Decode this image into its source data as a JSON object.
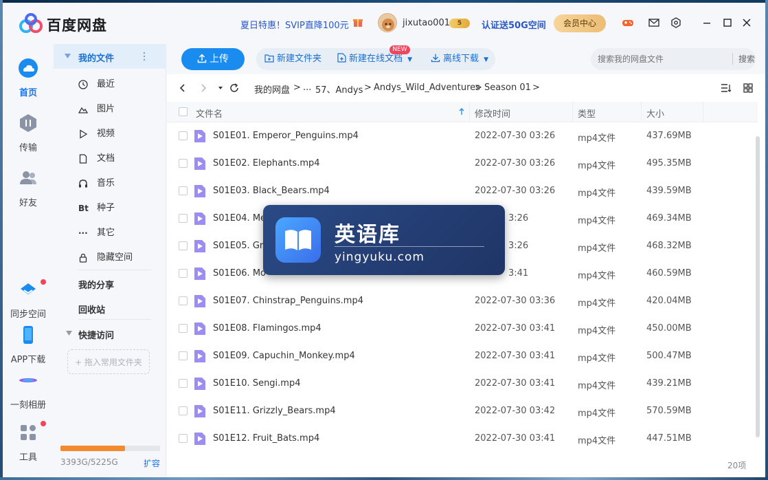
{
  "app": {
    "logo_text": "百度网盘",
    "promo": "夏日特惠！SVIP直降100元",
    "username": "jixutao001",
    "vip_badge": "5",
    "verify": "认证送50G空间",
    "member_center": "会员中心"
  },
  "leftnav": {
    "home": "首页",
    "transfer": "传输",
    "friends": "好友",
    "sync": "同步空间",
    "app_download": "APP下载",
    "moment_album": "一刻相册",
    "tools": "工具"
  },
  "sidebar": {
    "my_files": "我的文件",
    "items": [
      {
        "label": "最近",
        "icon": "clock-icon"
      },
      {
        "label": "图片",
        "icon": "image-icon"
      },
      {
        "label": "视频",
        "icon": "play-icon"
      },
      {
        "label": "文档",
        "icon": "document-icon"
      },
      {
        "label": "音乐",
        "icon": "headphones-icon"
      },
      {
        "label": "种子",
        "icon": "bt-icon"
      },
      {
        "label": "其它",
        "icon": "more-icon"
      },
      {
        "label": "隐藏空间",
        "icon": "lock-icon"
      }
    ],
    "my_share": "我的分享",
    "recycle": "回收站",
    "quick_access": "快捷访问",
    "quick_drop": "+ 拖入常用文件夹",
    "storage_text": "3393G/5225G",
    "storage_fraction": 0.65,
    "expand": "扩容"
  },
  "toolbar": {
    "upload": "上传",
    "new_folder": "新建文件夹",
    "new_online_doc": "新建在线文档",
    "new_badge": "NEW",
    "offline_download": "离线下载",
    "search_placeholder": "搜索我的网盘文件",
    "search_button": "搜索"
  },
  "path": {
    "root": "我的网盘",
    "ellipsis": "...",
    "p1": "57、Andys",
    "p2": "Andys_Wild_Adventures",
    "p3": "Season 01"
  },
  "table": {
    "col_name": "文件名",
    "col_time": "修改时间",
    "col_type": "类型",
    "col_size": "大小",
    "rows": [
      {
        "name": "S01E01. Emperor_Penguins.mp4",
        "time": "2022-07-30 03:26",
        "type": "mp4文件",
        "size": "437.69MB"
      },
      {
        "name": "S01E02. Elephants.mp4",
        "time": "2022-07-30 03:26",
        "type": "mp4文件",
        "size": "495.35MB"
      },
      {
        "name": "S01E03. Black_Bears.mp4",
        "time": "2022-07-30 03:26",
        "type": "mp4文件",
        "size": "439.59MB"
      },
      {
        "name": "S01E04. Mee",
        "time": "",
        "type": "mp4文件",
        "size": "469.34MB"
      },
      {
        "name": "S01E05. Gra",
        "time": "",
        "type": "mp4文件",
        "size": "468.32MB"
      },
      {
        "name": "S01E06. Mo",
        "time": "",
        "type": "mp4文件",
        "size": "460.59MB"
      },
      {
        "name": "S01E07. Chinstrap_Penguins.mp4",
        "time": "2022-07-30 03:36",
        "type": "mp4文件",
        "size": "420.04MB"
      },
      {
        "name": "S01E08. Flamingos.mp4",
        "time": "2022-07-30 03:41",
        "type": "mp4文件",
        "size": "450.00MB"
      },
      {
        "name": "S01E09. Capuchin_Monkey.mp4",
        "time": "2022-07-30 03:41",
        "type": "mp4文件",
        "size": "500.47MB"
      },
      {
        "name": "S01E10. Sengi.mp4",
        "time": "2022-07-30 03:41",
        "type": "mp4文件",
        "size": "439.21MB"
      },
      {
        "name": "S01E11. Grizzly_Bears.mp4",
        "time": "2022-07-30 03:42",
        "type": "mp4文件",
        "size": "570.59MB"
      },
      {
        "name": "S01E12. Fruit_Bats.mp4",
        "time": "2022-07-30 03:41",
        "type": "mp4文件",
        "size": "447.51MB"
      }
    ],
    "partial_times": [
      "3:26",
      "3:26",
      "3:41"
    ],
    "count": "20项"
  },
  "watermark": {
    "title": "英语库",
    "subtitle": "yingyuku.com"
  },
  "colors": {
    "accent": "#1a8cf0",
    "link": "#2a58c8",
    "storage": "#f48a2f",
    "badge_red": "#f0455c"
  }
}
